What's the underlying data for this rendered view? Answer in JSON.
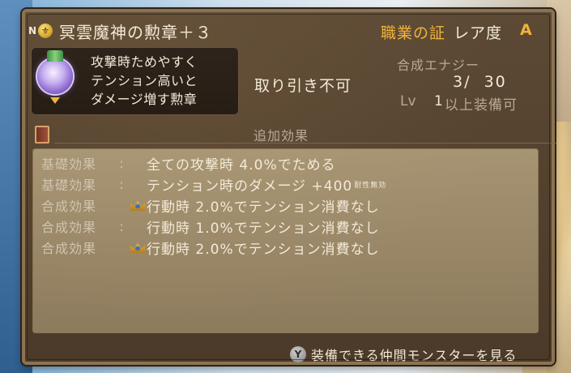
{
  "item": {
    "n_badge": "N",
    "title": "冥雲魔神の勲章＋３",
    "job_label": "職業の証",
    "rarity_label": "レア度",
    "rarity_grade": "A",
    "description": [
      "攻撃時ためやすく",
      "テンション高いと",
      "ダメージ増す勲章"
    ],
    "trade_status": "取り引き不可",
    "synthesis_label": "合成エナジー",
    "synthesis_value": "3/  30",
    "level_label": "Lv",
    "level_value": "1",
    "level_suffix": "以上装備可"
  },
  "effects": {
    "section_title": "追加効果",
    "rows": [
      {
        "label": "基礎効果",
        "sep": ":",
        "icon": "",
        "text": "全ての攻撃時 4.0%でためる",
        "note": ""
      },
      {
        "label": "基礎効果",
        "sep": ":",
        "icon": "",
        "text": "テンション時のダメージ +400",
        "note": "耐性無効"
      },
      {
        "label": "合成効果",
        "sep": "",
        "icon": "crown-icon",
        "text": "行動時 2.0%でテンション消費なし",
        "note": ""
      },
      {
        "label": "合成効果",
        "sep": ":",
        "icon": "",
        "text": "行動時 1.0%でテンション消費なし",
        "note": ""
      },
      {
        "label": "合成効果",
        "sep": "",
        "icon": "crown-icon",
        "text": "行動時 2.0%でテンション消費なし",
        "note": ""
      }
    ]
  },
  "footer": {
    "button": "Y",
    "text": "装備できる仲間モンスターを見る"
  },
  "colors": {
    "accent": "#f1b33b",
    "text": "#f3ead7",
    "muted": "#b9a995"
  }
}
